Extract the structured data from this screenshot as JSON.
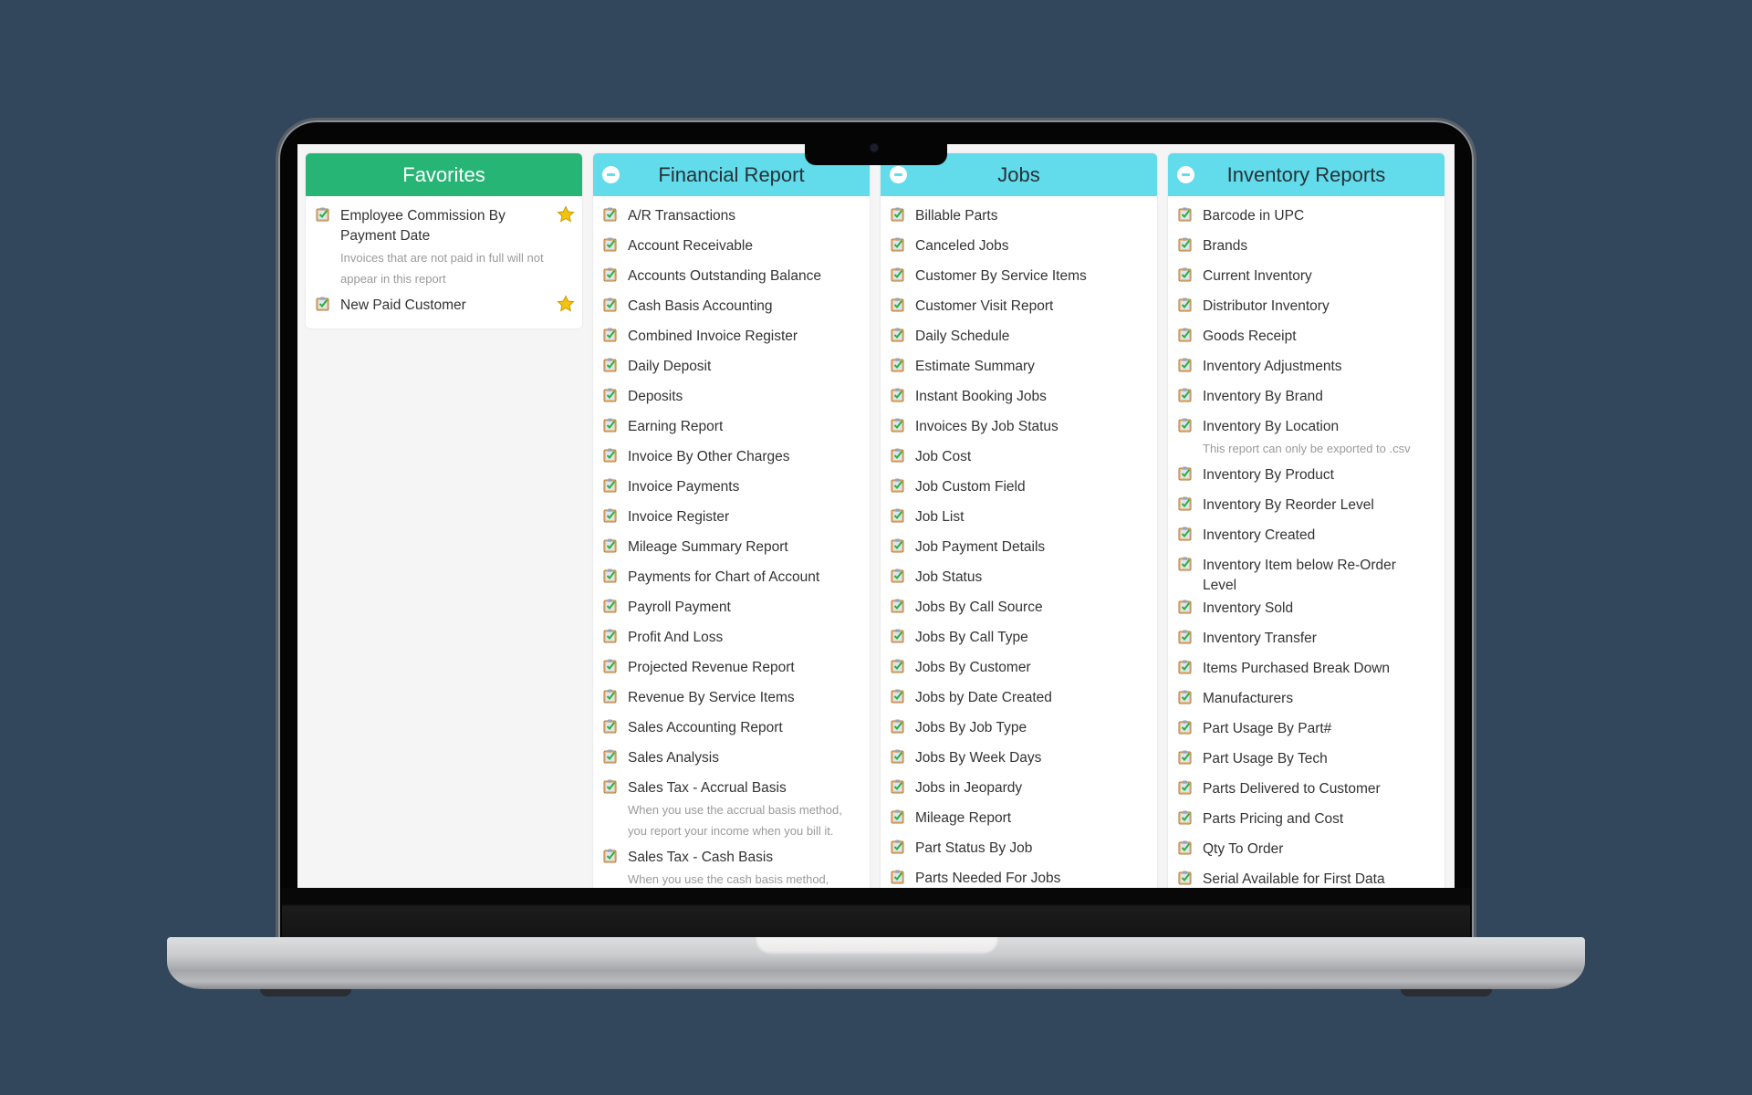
{
  "colors": {
    "background": "#33475c",
    "favorites_header": "#27b575",
    "section_header": "#62dbea",
    "item_text": "#333333",
    "description_text": "#9a9a9a",
    "star": "#f2c40f"
  },
  "favorites": {
    "title": "Favorites",
    "items": [
      {
        "label": "Employee Commission By Payment Date",
        "description": "Invoices that are not paid in full will not appear in this report",
        "icon": "report-icon",
        "starred": true
      },
      {
        "label": "New Paid Customer",
        "icon": "report-icon",
        "starred": true
      }
    ]
  },
  "sections": [
    {
      "title": "Financial Report",
      "collapse_icon": "minus-circle-icon",
      "items": [
        {
          "label": "A/R Transactions"
        },
        {
          "label": "Account Receivable"
        },
        {
          "label": "Accounts Outstanding Balance"
        },
        {
          "label": "Cash Basis Accounting"
        },
        {
          "label": "Combined Invoice Register"
        },
        {
          "label": "Daily Deposit"
        },
        {
          "label": "Deposits"
        },
        {
          "label": "Earning Report"
        },
        {
          "label": "Invoice By Other Charges"
        },
        {
          "label": "Invoice Payments"
        },
        {
          "label": "Invoice Register"
        },
        {
          "label": "Mileage Summary Report"
        },
        {
          "label": "Payments for Chart of Account"
        },
        {
          "label": "Payroll Payment"
        },
        {
          "label": "Profit And Loss"
        },
        {
          "label": "Projected Revenue Report"
        },
        {
          "label": "Revenue By Service Items"
        },
        {
          "label": "Sales Accounting Report"
        },
        {
          "label": "Sales Analysis"
        },
        {
          "label": "Sales Tax - Accrual Basis",
          "description": "When you use the accrual basis method, you report your income when you bill it."
        },
        {
          "label": "Sales Tax - Cash Basis",
          "description": "When you use the cash basis method,"
        }
      ]
    },
    {
      "title": "Jobs",
      "collapse_icon": "minus-circle-icon",
      "items": [
        {
          "label": "Billable Parts"
        },
        {
          "label": "Canceled Jobs"
        },
        {
          "label": "Customer By Service Items"
        },
        {
          "label": "Customer Visit Report"
        },
        {
          "label": "Daily Schedule"
        },
        {
          "label": "Estimate Summary"
        },
        {
          "label": "Instant Booking Jobs"
        },
        {
          "label": "Invoices By Job Status"
        },
        {
          "label": "Job Cost"
        },
        {
          "label": "Job Custom Field"
        },
        {
          "label": "Job List"
        },
        {
          "label": "Job Payment Details"
        },
        {
          "label": "Job Status"
        },
        {
          "label": "Jobs By Call Source"
        },
        {
          "label": "Jobs By Call Type"
        },
        {
          "label": "Jobs By Customer"
        },
        {
          "label": "Jobs by Date Created"
        },
        {
          "label": "Jobs By Job Type"
        },
        {
          "label": "Jobs By Week Days"
        },
        {
          "label": "Jobs in Jeopardy"
        },
        {
          "label": "Mileage Report"
        },
        {
          "label": "Part Status By Job"
        },
        {
          "label": "Parts Needed For Jobs"
        }
      ]
    },
    {
      "title": "Inventory Reports",
      "collapse_icon": "minus-circle-icon",
      "items": [
        {
          "label": "Barcode in UPC"
        },
        {
          "label": "Brands"
        },
        {
          "label": "Current Inventory"
        },
        {
          "label": "Distributor Inventory"
        },
        {
          "label": "Goods Receipt"
        },
        {
          "label": "Inventory Adjustments"
        },
        {
          "label": "Inventory By Brand"
        },
        {
          "label": "Inventory By Location",
          "description": "This report can only be exported to .csv"
        },
        {
          "label": "Inventory By Product"
        },
        {
          "label": "Inventory By Reorder Level"
        },
        {
          "label": "Inventory Created"
        },
        {
          "label": "Inventory Item below Re-Order Level"
        },
        {
          "label": "Inventory Sold"
        },
        {
          "label": "Inventory Transfer"
        },
        {
          "label": "Items Purchased Break Down"
        },
        {
          "label": "Manufacturers"
        },
        {
          "label": "Part Usage By Part#"
        },
        {
          "label": "Part Usage By Tech"
        },
        {
          "label": "Parts Delivered to Customer"
        },
        {
          "label": "Parts Pricing and Cost"
        },
        {
          "label": "Qty To Order"
        },
        {
          "label": "Serial Available for First Data"
        }
      ]
    }
  ]
}
